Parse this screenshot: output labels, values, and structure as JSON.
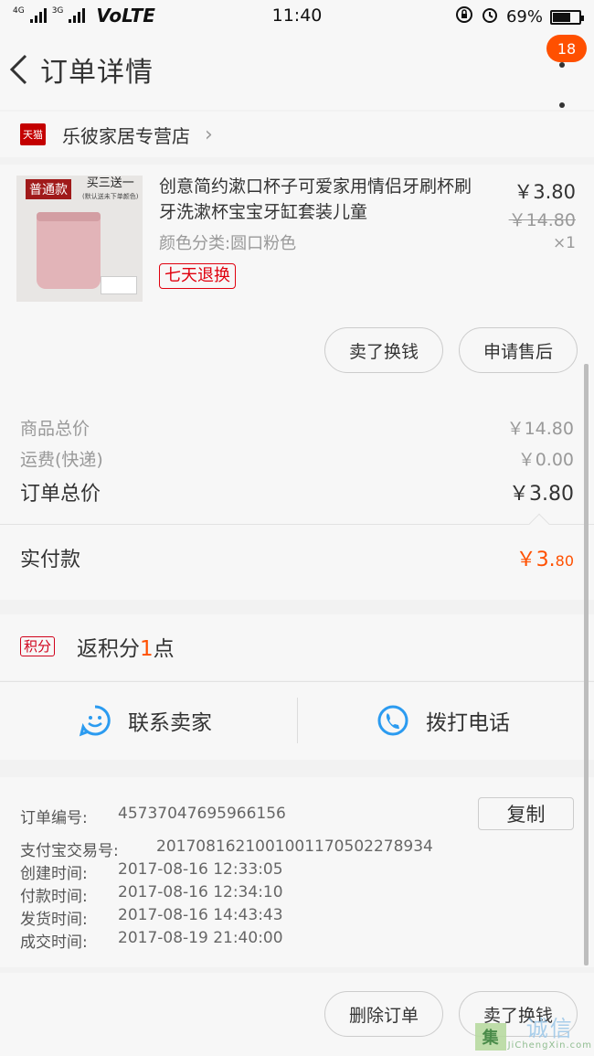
{
  "status_bar": {
    "network_top": "4G",
    "network_2": "3G",
    "volte": "VoLTE",
    "time": "11:40",
    "battery": "69%",
    "battery_level": 0.69
  },
  "header": {
    "title": "订单详情",
    "notification_count": "18"
  },
  "shop": {
    "badge": "天猫",
    "name": "乐彼家居专营店"
  },
  "product": {
    "thumb_tag": "普通款",
    "thumb_promo": "买三送一",
    "thumb_promo_small": "(默认送未下单颜色)",
    "title": "创意简约漱口杯子可爱家用情侣牙刷杯刷牙洗漱杯宝宝牙缸套装儿童",
    "attribute": "颜色分类:圆口粉色",
    "service_tag": "七天退换",
    "price": "￥3.80",
    "original_price": "￥14.80",
    "quantity": "×1",
    "sell_button": "卖了换钱",
    "aftersale_button": "申请售后"
  },
  "totals": {
    "goods_label": "商品总价",
    "goods_value": "￥14.80",
    "shipping_label": "运费(快递)",
    "shipping_value": "￥0.00",
    "order_label": "订单总价",
    "order_value": "￥3.80",
    "paid_label": "实付款",
    "paid_main": "￥3.",
    "paid_cents": "80"
  },
  "points": {
    "badge": "积分",
    "prefix": "返积分",
    "count": "1",
    "suffix": "点"
  },
  "contact": {
    "seller": "联系卖家",
    "phone": "拨打电话",
    "accent": "#2b9bf0"
  },
  "order_info": {
    "copy_button": "复制",
    "rows": [
      {
        "label": "订单编号:",
        "value": "45737047695966156"
      },
      {
        "label": "支付宝交易号:",
        "value": "2017081621001001170502278934"
      },
      {
        "label": "创建时间:",
        "value": "2017-08-16 12:33:05"
      },
      {
        "label": "付款时间:",
        "value": "2017-08-16 12:34:10"
      },
      {
        "label": "发货时间:",
        "value": "2017-08-16 14:43:43"
      },
      {
        "label": "成交时间:",
        "value": "2017-08-19 21:40:00"
      }
    ]
  },
  "bottom_bar": {
    "delete_button": "删除订单",
    "sell_button": "卖了换钱"
  },
  "watermark": {
    "logo": "集",
    "text": "诚信",
    "small": "JiChengXin.com"
  },
  "colors": {
    "accent_orange": "#ff5000",
    "tmall_red": "#c40000"
  }
}
